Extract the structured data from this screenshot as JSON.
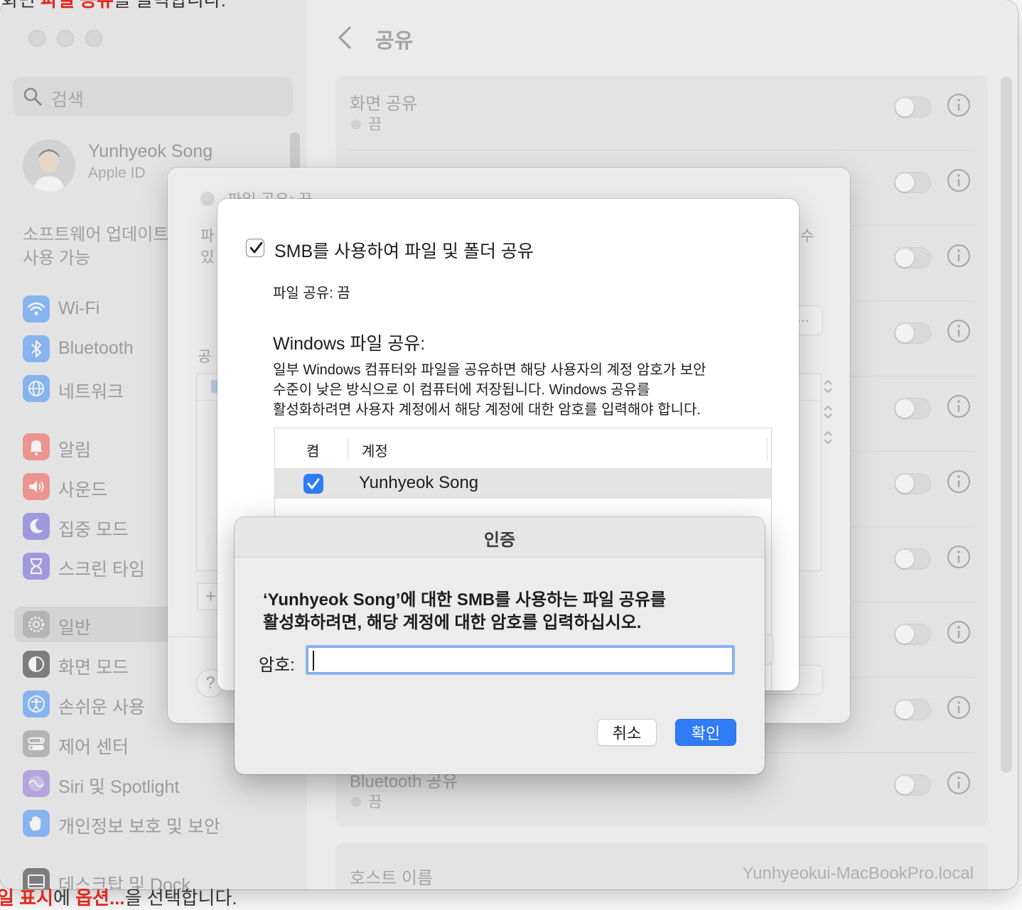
{
  "captions": {
    "top_a": "화면",
    "top_b": "파일 공유",
    "top_c": "를 클릭합니다.",
    "bottom_a": "일 표시",
    "bottom_b": "에 ",
    "bottom_c": "옵션...",
    "bottom_d": "을 선택합니다."
  },
  "sidebar": {
    "search_placeholder": "검색",
    "profile_name": "Yunhyeok Song",
    "profile_sub": "Apple ID",
    "update_line1": "소프트웨어 업데이트",
    "update_line2": "사용 가능",
    "items": [
      {
        "label": "Wi-Fi",
        "icon": "wifi-icon",
        "color": "#3d8ef7"
      },
      {
        "label": "Bluetooth",
        "icon": "bluetooth-icon",
        "color": "#3d8ef7"
      },
      {
        "label": "네트워크",
        "icon": "globe-icon",
        "color": "#3d8ef7"
      },
      {
        "label": "알림",
        "icon": "bell-icon",
        "color": "#f2554d"
      },
      {
        "label": "사운드",
        "icon": "speaker-icon",
        "color": "#f2554d"
      },
      {
        "label": "집중 모드",
        "icon": "moon-icon",
        "color": "#6a5cd6"
      },
      {
        "label": "스크린 타임",
        "icon": "hourglass-icon",
        "color": "#6a5cd6"
      },
      {
        "label": "일반",
        "icon": "gear-icon",
        "color": "#9a9a9a"
      },
      {
        "label": "화면 모드",
        "icon": "appearance-icon",
        "color": "#2a2a2a"
      },
      {
        "label": "손쉬운 사용",
        "icon": "accessibility-icon",
        "color": "#3d8ef7"
      },
      {
        "label": "제어 센터",
        "icon": "control-center-icon",
        "color": "#8f8f8f"
      },
      {
        "label": "Siri 및 Spotlight",
        "icon": "siri-icon",
        "color": "#8e6fd8"
      },
      {
        "label": "개인정보 보호 및 보안",
        "icon": "hand-icon",
        "color": "#3d8ef7"
      },
      {
        "label": "데스크탑 및 Dock",
        "icon": "dock-icon",
        "color": "#2a2a2a"
      }
    ]
  },
  "content": {
    "title": "공유",
    "services": [
      {
        "title": "화면 공유",
        "status": "끔"
      },
      {
        "title": "Bluetooth 공유",
        "status": "끔"
      }
    ],
    "host_label": "호스트 이름",
    "host_value": "Yunhyeokui-MacBookPro.local"
  },
  "sheet1": {
    "status": "파일 공유: 끔",
    "frag_desc1": "파",
    "frag_desc2": "있",
    "frag_right": "수",
    "frag_shared": "공",
    "frag_options_btn": "...",
    "help": "?",
    "add": "+"
  },
  "sheet2": {
    "smb_label": "SMB를 사용하여 파일 및 폴더 공유",
    "fs_status": "파일 공유: 끔",
    "win_title": "Windows 파일 공유:",
    "desc_lines": [
      "일부 Windows 컴퓨터와 파일을 공유하면 해당 사용자의 계정 암호가 보안",
      "수준이 낮은 방식으로 이 컴퓨터에 저장됩니다. Windows 공유를",
      "활성화하려면 사용자 계정에서 해당 계정에 대한 암호를 입력해야 합니다."
    ],
    "col_on": "켬",
    "col_account": "계정",
    "account_name": "Yunhyeok Song",
    "account_checked": true
  },
  "auth": {
    "title": "인증",
    "message_line1": "‘Yunhyeok Song’에 대한 SMB를 사용하는 파일 공유를",
    "message_line2": "활성화하려면, 해당 계정에 대한 암호를 입력하십시오.",
    "password_label": "암호:",
    "password_value": "",
    "cancel": "취소",
    "ok": "확인",
    "accent": "#2f7cf6"
  }
}
